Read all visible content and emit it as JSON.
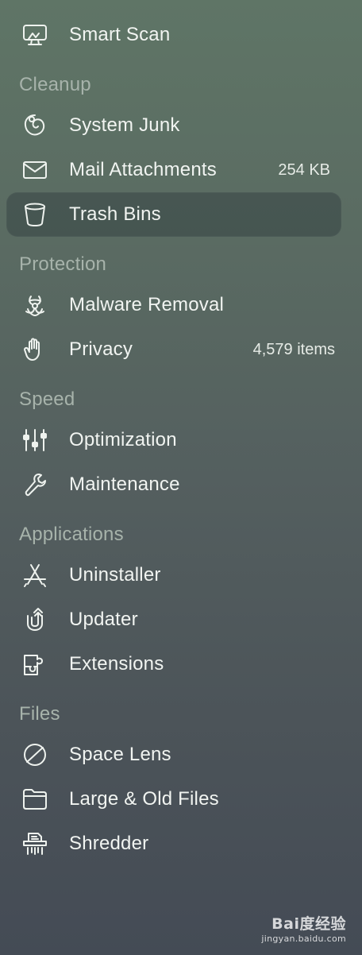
{
  "sidebar": {
    "top_item": {
      "label": "Smart Scan",
      "icon": "monitor-icon"
    },
    "sections": [
      {
        "title": "Cleanup",
        "items": [
          {
            "label": "System Junk",
            "icon": "swirl-icon",
            "meta": ""
          },
          {
            "label": "Mail Attachments",
            "icon": "envelope-icon",
            "meta": "254 KB"
          },
          {
            "label": "Trash Bins",
            "icon": "trash-bin-icon",
            "meta": "",
            "selected": true
          }
        ]
      },
      {
        "title": "Protection",
        "items": [
          {
            "label": "Malware Removal",
            "icon": "biohazard-icon",
            "meta": ""
          },
          {
            "label": "Privacy",
            "icon": "hand-icon",
            "meta": "4,579 items"
          }
        ]
      },
      {
        "title": "Speed",
        "items": [
          {
            "label": "Optimization",
            "icon": "sliders-icon",
            "meta": ""
          },
          {
            "label": "Maintenance",
            "icon": "wrench-icon",
            "meta": ""
          }
        ]
      },
      {
        "title": "Applications",
        "items": [
          {
            "label": "Uninstaller",
            "icon": "app-store-icon",
            "meta": ""
          },
          {
            "label": "Updater",
            "icon": "update-arrow-icon",
            "meta": ""
          },
          {
            "label": "Extensions",
            "icon": "puzzle-icon",
            "meta": ""
          }
        ]
      },
      {
        "title": "Files",
        "items": [
          {
            "label": "Space Lens",
            "icon": "planet-icon",
            "meta": ""
          },
          {
            "label": "Large & Old Files",
            "icon": "folder-icon",
            "meta": ""
          },
          {
            "label": "Shredder",
            "icon": "shredder-icon",
            "meta": ""
          }
        ]
      }
    ]
  },
  "watermark": {
    "logo": "Bai度经验",
    "url": "jingyan.baidu.com"
  },
  "colors": {
    "background_top": "#5f7566",
    "background_bottom": "#444b55",
    "label": "#f1f4f1",
    "section_title": "#a7b3ab",
    "selected_bg": "rgba(40,50,55,0.38)"
  }
}
